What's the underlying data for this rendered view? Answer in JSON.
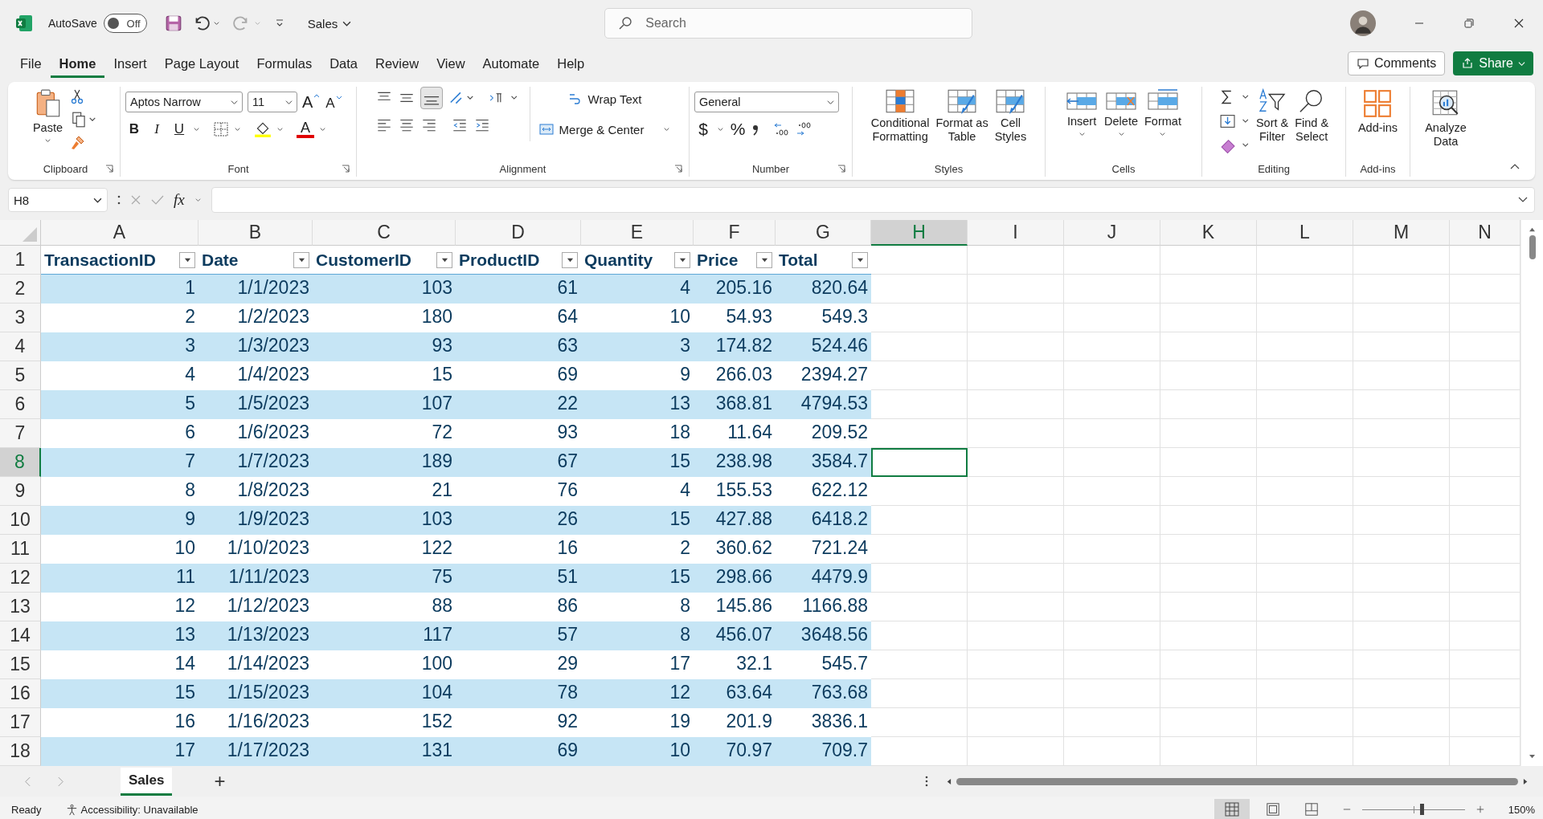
{
  "title_bar": {
    "autosave_label": "AutoSave",
    "autosave_state": "Off",
    "autosave_on": false,
    "file_name": "Sales",
    "search_placeholder": "Search"
  },
  "menu_tabs": [
    {
      "label": "File",
      "selected": false
    },
    {
      "label": "Home",
      "selected": true
    },
    {
      "label": "Insert",
      "selected": false
    },
    {
      "label": "Page Layout",
      "selected": false
    },
    {
      "label": "Formulas",
      "selected": false
    },
    {
      "label": "Data",
      "selected": false
    },
    {
      "label": "Review",
      "selected": false
    },
    {
      "label": "View",
      "selected": false
    },
    {
      "label": "Automate",
      "selected": false
    },
    {
      "label": "Help",
      "selected": false
    }
  ],
  "comments_button": "Comments",
  "share_button": "Share",
  "ribbon": {
    "clipboard": {
      "label": "Clipboard",
      "paste": "Paste"
    },
    "font": {
      "label": "Font",
      "font_name": "Aptos Narrow",
      "font_size": "11",
      "grow": "A",
      "shrink": "A",
      "bold": "B",
      "italic": "I",
      "underline": "U",
      "font_color": "A"
    },
    "alignment": {
      "label": "Alignment",
      "wrap_text": "Wrap Text",
      "merge_center": "Merge & Center"
    },
    "number": {
      "label": "Number",
      "format": "General",
      "currency": "$",
      "percent": "%"
    },
    "styles": {
      "label": "Styles",
      "buttons": [
        "Conditional\nFormatting",
        "Format as\nTable",
        "Cell\nStyles"
      ]
    },
    "cells": {
      "label": "Cells",
      "buttons": [
        "Insert",
        "Delete",
        "Format"
      ]
    },
    "editing": {
      "label": "Editing",
      "buttons": [
        "Sort &\nFilter",
        "Find &\nSelect"
      ]
    },
    "addins": {
      "label": "Add-ins",
      "button": "Add-ins"
    },
    "analyze": {
      "button": "Analyze\nData"
    }
  },
  "formula_bar": {
    "name_box": "H8",
    "fx": "fx"
  },
  "sheet": {
    "columns": [
      {
        "letter": "A",
        "selected": false
      },
      {
        "letter": "B",
        "selected": false
      },
      {
        "letter": "C",
        "selected": false
      },
      {
        "letter": "D",
        "selected": false
      },
      {
        "letter": "E",
        "selected": false
      },
      {
        "letter": "F",
        "selected": false
      },
      {
        "letter": "G",
        "selected": false
      },
      {
        "letter": "H",
        "selected": true
      },
      {
        "letter": "I",
        "selected": false
      },
      {
        "letter": "J",
        "selected": false
      },
      {
        "letter": "K",
        "selected": false
      },
      {
        "letter": "L",
        "selected": false
      },
      {
        "letter": "M",
        "selected": false
      },
      {
        "letter": "N",
        "selected": false
      }
    ],
    "rows": [
      {
        "number": "1",
        "selected": false
      },
      {
        "number": "2",
        "selected": false
      },
      {
        "number": "3",
        "selected": false
      },
      {
        "number": "4",
        "selected": false
      },
      {
        "number": "5",
        "selected": false
      },
      {
        "number": "6",
        "selected": false
      },
      {
        "number": "7",
        "selected": false
      },
      {
        "number": "8",
        "selected": true
      },
      {
        "number": "9",
        "selected": false
      },
      {
        "number": "10",
        "selected": false
      },
      {
        "number": "11",
        "selected": false
      },
      {
        "number": "12",
        "selected": false
      },
      {
        "number": "13",
        "selected": false
      },
      {
        "number": "14",
        "selected": false
      },
      {
        "number": "15",
        "selected": false
      },
      {
        "number": "16",
        "selected": false
      },
      {
        "number": "17",
        "selected": false
      },
      {
        "number": "18",
        "selected": false
      }
    ],
    "table_headers": [
      "TransactionID",
      "Date",
      "CustomerID",
      "ProductID",
      "Quantity",
      "Price",
      "Total"
    ],
    "table_rows": [
      [
        "1",
        "1/1/2023",
        "103",
        "61",
        "4",
        "205.16",
        "820.64"
      ],
      [
        "2",
        "1/2/2023",
        "180",
        "64",
        "10",
        "54.93",
        "549.3"
      ],
      [
        "3",
        "1/3/2023",
        "93",
        "63",
        "3",
        "174.82",
        "524.46"
      ],
      [
        "4",
        "1/4/2023",
        "15",
        "69",
        "9",
        "266.03",
        "2394.27"
      ],
      [
        "5",
        "1/5/2023",
        "107",
        "22",
        "13",
        "368.81",
        "4794.53"
      ],
      [
        "6",
        "1/6/2023",
        "72",
        "93",
        "18",
        "11.64",
        "209.52"
      ],
      [
        "7",
        "1/7/2023",
        "189",
        "67",
        "15",
        "238.98",
        "3584.7"
      ],
      [
        "8",
        "1/8/2023",
        "21",
        "76",
        "4",
        "155.53",
        "622.12"
      ],
      [
        "9",
        "1/9/2023",
        "103",
        "26",
        "15",
        "427.88",
        "6418.2"
      ],
      [
        "10",
        "1/10/2023",
        "122",
        "16",
        "2",
        "360.62",
        "721.24"
      ],
      [
        "11",
        "1/11/2023",
        "75",
        "51",
        "15",
        "298.66",
        "4479.9"
      ],
      [
        "12",
        "1/12/2023",
        "88",
        "86",
        "8",
        "145.86",
        "1166.88"
      ],
      [
        "13",
        "1/13/2023",
        "117",
        "57",
        "8",
        "456.07",
        "3648.56"
      ],
      [
        "14",
        "1/14/2023",
        "100",
        "29",
        "17",
        "32.1",
        "545.7"
      ],
      [
        "15",
        "1/15/2023",
        "104",
        "78",
        "12",
        "63.64",
        "763.68"
      ],
      [
        "16",
        "1/16/2023",
        "152",
        "92",
        "19",
        "201.9",
        "3836.1"
      ],
      [
        "17",
        "1/17/2023",
        "131",
        "69",
        "10",
        "70.97",
        "709.7"
      ]
    ]
  },
  "sheet_tabs": [
    {
      "label": "Sales",
      "selected": true
    }
  ],
  "new_sheet": "+",
  "status_bar": {
    "ready": "Ready",
    "accessibility": "Accessibility: Unavailable",
    "zoom": "150%",
    "zoom_slider": {
      "level": 0.58
    }
  }
}
